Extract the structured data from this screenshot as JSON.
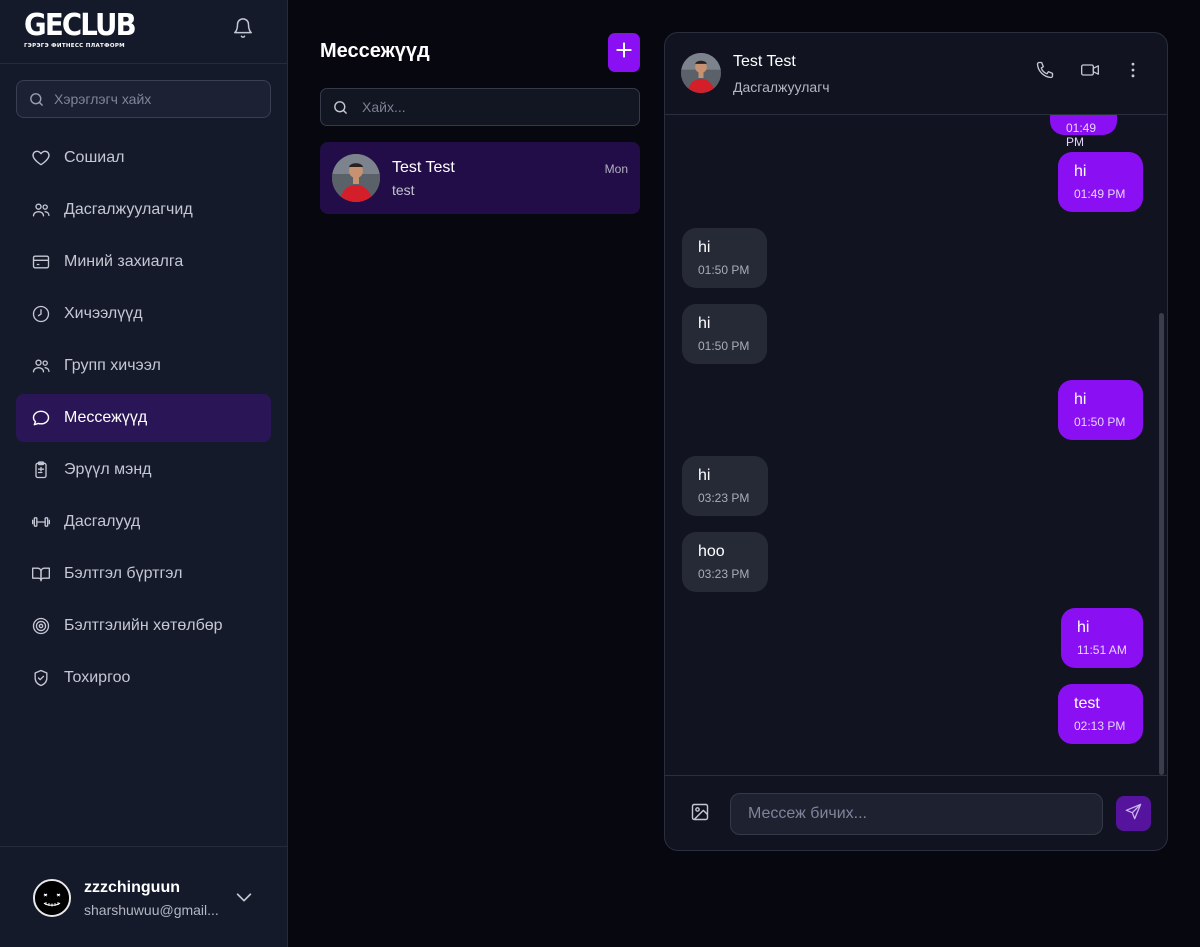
{
  "app": {
    "logo_main": "GECLUB",
    "logo_sub": "ГЭРЭГЭ ФИТНЕСС ПЛАТФОРМ"
  },
  "sidebar": {
    "search_placeholder": "Хэрэглэгч хайх",
    "items": [
      {
        "label": "Сошиал",
        "icon": "heart-icon"
      },
      {
        "label": "Дасгалжуулагчид",
        "icon": "users-icon"
      },
      {
        "label": "Миний захиалга",
        "icon": "credit-card-icon"
      },
      {
        "label": "Хичээлүүд",
        "icon": "clock-icon"
      },
      {
        "label": "Групп хичээл",
        "icon": "users-icon"
      },
      {
        "label": "Мессежүүд",
        "icon": "message-icon"
      },
      {
        "label": "Эрүүл мэнд",
        "icon": "clipboard-icon"
      },
      {
        "label": "Дасгалууд",
        "icon": "dumbbell-icon"
      },
      {
        "label": "Бэлтгэл бүртгэл",
        "icon": "book-open-icon"
      },
      {
        "label": "Бэлтгэлийн хөтөлбөр",
        "icon": "target-icon"
      },
      {
        "label": "Тохиргоо",
        "icon": "shield-check-icon"
      }
    ],
    "active_index": 5
  },
  "profile": {
    "name": "zzzchinguun",
    "email": "sharshuwuu@gmail..."
  },
  "conversations": {
    "title": "Мессежүүд",
    "search_placeholder": "Хайх...",
    "items": [
      {
        "name": "Test Test",
        "last_message": "test",
        "time": "Mon"
      }
    ]
  },
  "chat": {
    "name": "Test Test",
    "role": "Дасгалжуулагч",
    "input_placeholder": "Мессеж бичих...",
    "messages": [
      {
        "direction": "out",
        "text": "",
        "time": "01:49 PM"
      },
      {
        "direction": "out",
        "text": "hi",
        "time": "01:49 PM"
      },
      {
        "direction": "in",
        "text": "hi",
        "time": "01:50 PM"
      },
      {
        "direction": "in",
        "text": "hi",
        "time": "01:50 PM"
      },
      {
        "direction": "out",
        "text": "hi",
        "time": "01:50 PM"
      },
      {
        "direction": "in",
        "text": "hi",
        "time": "03:23 PM"
      },
      {
        "direction": "in",
        "text": "hoo",
        "time": "03:23 PM"
      },
      {
        "direction": "out",
        "text": "hi",
        "time": "11:51 AM"
      },
      {
        "direction": "out",
        "text": "test",
        "time": "02:13 PM"
      }
    ]
  },
  "colors": {
    "accent": "#8a0ff2",
    "active_nav": "#2a1657",
    "sidebar_bg": "#151a2b",
    "page_bg": "#07070f"
  }
}
